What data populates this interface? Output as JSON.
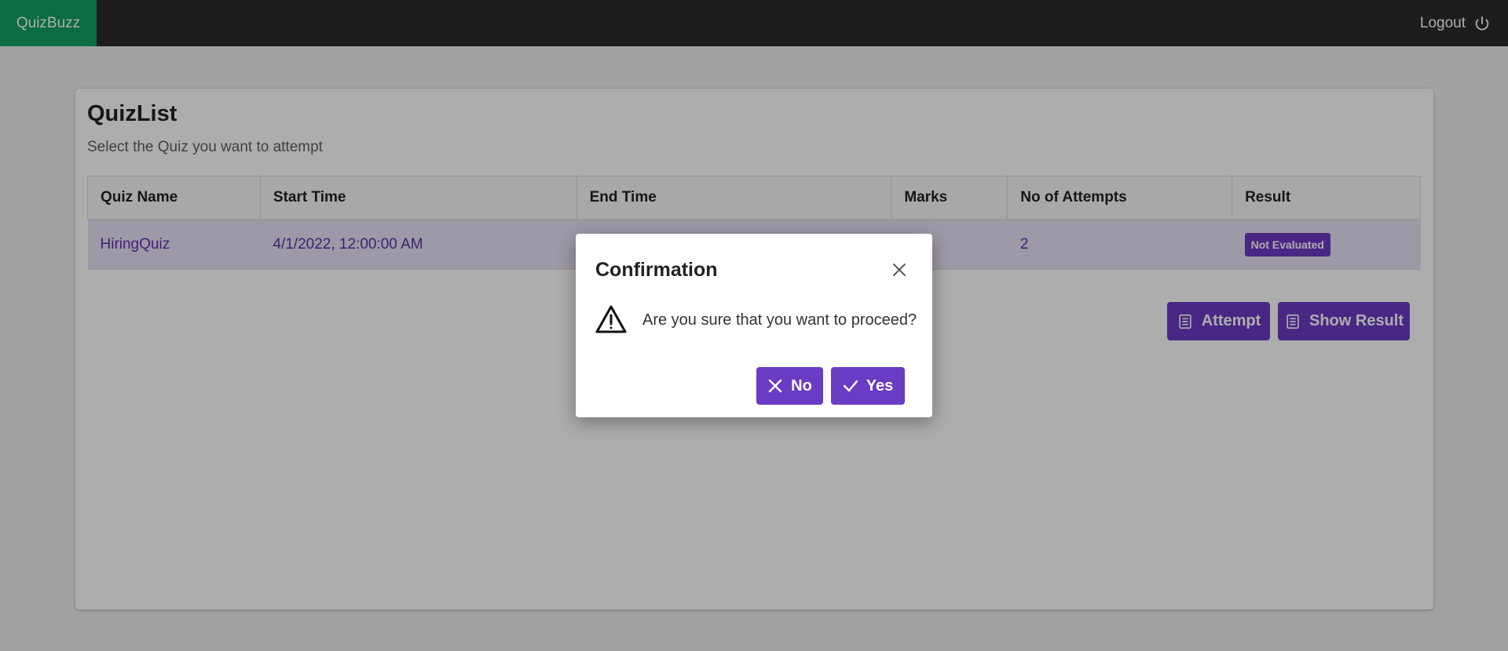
{
  "navbar": {
    "brand": "QuizBuzz",
    "logout_label": "Logout"
  },
  "card": {
    "title": "QuizList",
    "subtitle": "Select the Quiz you want to attempt"
  },
  "table": {
    "headers": [
      "Quiz Name",
      "Start Time",
      "End Time",
      "Marks",
      "No of Attempts",
      "Result"
    ],
    "rows": [
      {
        "quiz_name": "HiringQuiz",
        "start_time": "4/1/2022, 12:00:00 AM",
        "end_time": "",
        "marks": "",
        "attempts": "2",
        "result": "Not Evaluated"
      }
    ]
  },
  "actions": {
    "attempt_label": "Attempt",
    "show_result_label": "Show Result"
  },
  "dialog": {
    "title": "Confirmation",
    "message": "Are you sure that you want to proceed?",
    "no_label": "No",
    "yes_label": "Yes"
  },
  "colors": {
    "accent": "#6a3bc3",
    "brand": "#0f9f5f",
    "navbar": "#2b2b2b"
  }
}
